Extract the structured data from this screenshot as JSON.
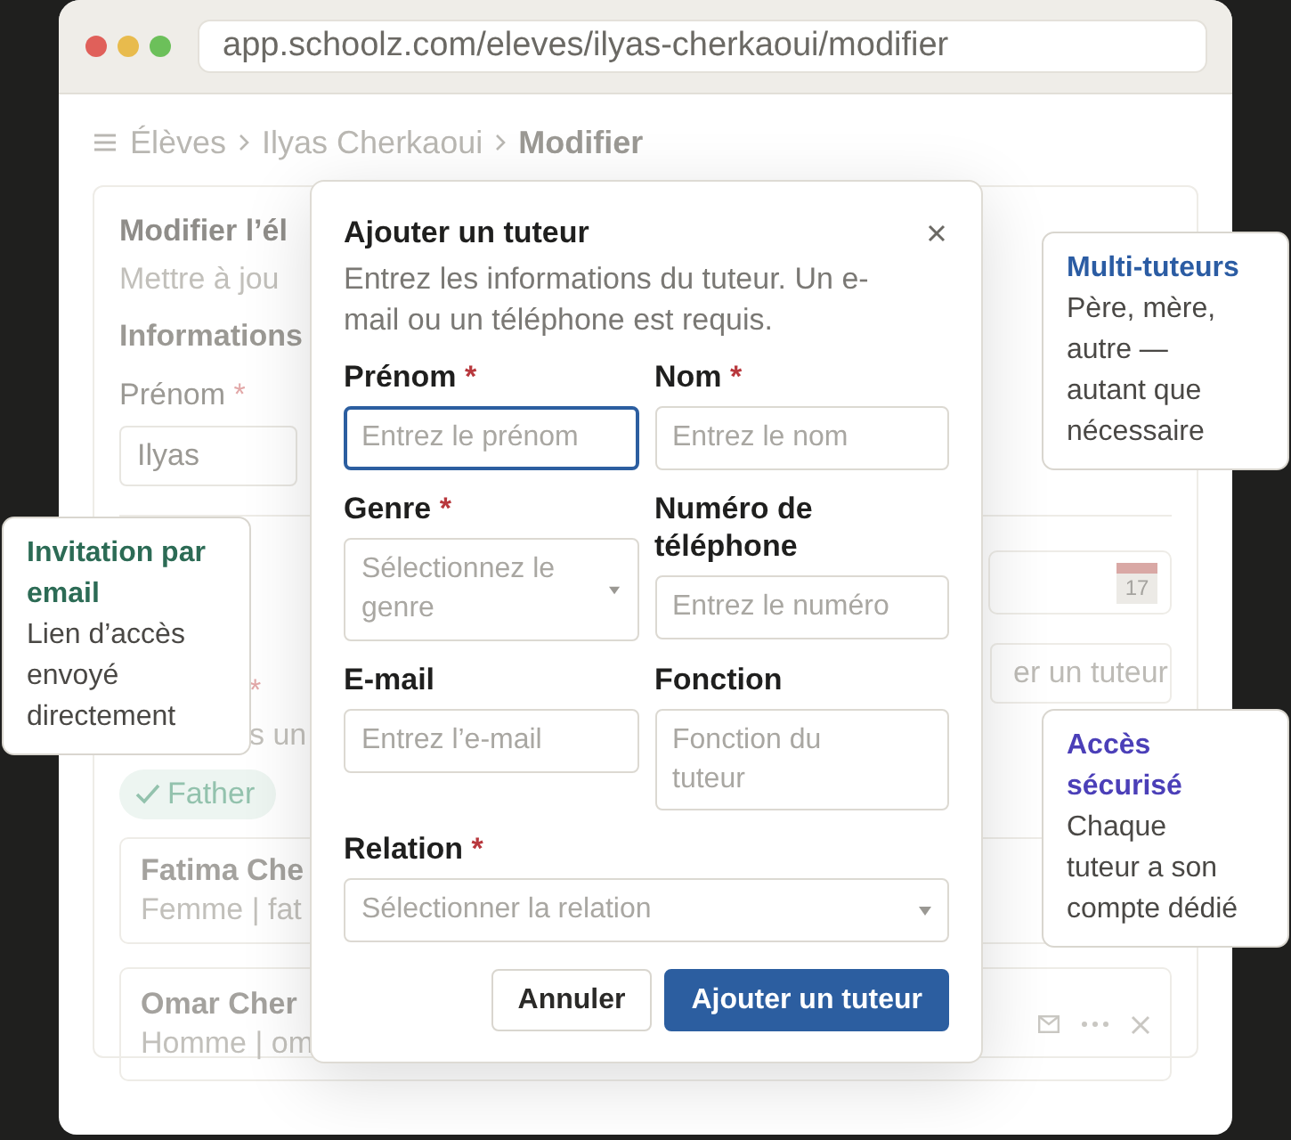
{
  "browser": {
    "url": "app.schoolz.com/eleves/ilyas-cherkaoui/modifier"
  },
  "breadcrumb": [
    {
      "label": "Élèves",
      "current": false
    },
    {
      "label": "Ilyas Cherkaoui",
      "current": false
    },
    {
      "label": "Modifier",
      "current": true
    }
  ],
  "background_form": {
    "title": "Modifier l’él",
    "subtitle": "Mettre à jou",
    "section": "Informations",
    "first_name": {
      "label": "Prénom",
      "required_mark": "*",
      "value": "Ilyas"
    },
    "date_field": {
      "calendar_day": "17"
    },
    "guardians_field": {
      "required_mark": "*",
      "hint": "s un",
      "button_text": "er un tuteur"
    },
    "chips": [
      {
        "label": "Father",
        "checked": true
      }
    ],
    "guardians": [
      {
        "name": "Fatima Che",
        "details": "Femme | fat",
        "actions_visible": false
      },
      {
        "name": "Omar Cher",
        "details": "Homme | om",
        "actions_visible": true
      }
    ]
  },
  "modal": {
    "title": "Ajouter un tuteur",
    "description": "Entrez les informations du tuteur. Un e-mail ou un téléphone est requis.",
    "fields": [
      {
        "kind": "text",
        "label": "Prénom",
        "required_mark": "*",
        "placeholder": "Entrez le prénom",
        "focused": true
      },
      {
        "kind": "text",
        "label": "Nom",
        "required_mark": "*",
        "placeholder": "Entrez le nom",
        "focused": false
      },
      {
        "kind": "select",
        "label": "Genre",
        "required_mark": "*",
        "placeholder": "Sélectionnez le genre",
        "focused": false
      },
      {
        "kind": "text",
        "label": "Numéro de téléphone",
        "placeholder": "Entrez le numéro",
        "focused": false
      },
      {
        "kind": "text",
        "label": "E-mail",
        "placeholder": "Entrez l’e-mail",
        "focused": false
      },
      {
        "kind": "textarea",
        "label": "Fonction",
        "placeholder": "Fonction du tuteur",
        "focused": false
      },
      {
        "kind": "select",
        "label": "Relation",
        "required_mark": "*",
        "placeholder": "Sélectionner la relation",
        "focused": false
      }
    ],
    "buttons": [
      {
        "kind": "secondary",
        "label": "Annuler"
      },
      {
        "kind": "primary",
        "label": "Ajouter un tuteur"
      }
    ]
  },
  "callouts": [
    {
      "title": "Multi-tuteurs",
      "body": "Père, mère, autre — autant que nécessaire",
      "color": "#2b5ca3"
    },
    {
      "title": "Invitation par email",
      "body": "Lien d’accès envoyé directement",
      "color": "#2c6b55"
    },
    {
      "title": "Accès sécurisé",
      "body": "Chaque tuteur a son compte dédié",
      "color": "#4b3fb8"
    }
  ]
}
